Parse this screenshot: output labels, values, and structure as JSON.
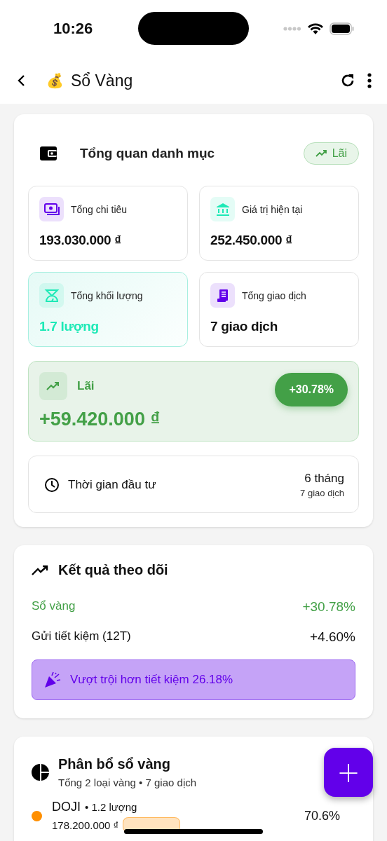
{
  "status_bar": {
    "time": "10:26"
  },
  "app_bar": {
    "emoji": "💰",
    "title": "Sổ Vàng"
  },
  "overview": {
    "title": "Tổng quan danh mục",
    "badge": "Lãi",
    "tiles": [
      {
        "label": "Tổng chi tiêu",
        "value": "193.030.000 ₫",
        "kind": "money",
        "color": "#6200ea",
        "highlighted": false
      },
      {
        "label": "Giá trị hiện tại",
        "value": "252.450.000 ₫",
        "kind": "bank",
        "color": "#1de9b6",
        "highlighted": false
      },
      {
        "label": "Tổng khối lượng",
        "value": "1.7 lượng",
        "kind": "scale",
        "color": "#1de9b6",
        "highlighted": true
      },
      {
        "label": "Tổng giao dịch",
        "value": "7 giao dịch",
        "kind": "receipt",
        "color": "#6200ea",
        "highlighted": false
      }
    ],
    "profit": {
      "label": "Lãi",
      "amount": "+59.420.000 ₫",
      "percent": "+30.78%"
    },
    "duration": {
      "label": "Thời gian đầu tư",
      "value": "6 tháng",
      "sub": "7 giao dịch"
    }
  },
  "results": {
    "title": "Kết quả theo dõi",
    "rows": [
      {
        "label": "Sổ vàng",
        "value": "+30.78%",
        "highlighted": true
      },
      {
        "label": "Gửi tiết kiệm (12T)",
        "value": "+4.60%",
        "highlighted": false
      }
    ],
    "banner": "Vượt trội hơn tiết kiệm 26.18%"
  },
  "allocation": {
    "title": "Phân bổ sổ vàng",
    "subtitle": "Tổng 2 loại vàng • 7 giao dịch",
    "items": [
      {
        "name": "DOJI",
        "amount": "• 1.2 lượng",
        "value": "178.200.000 ₫",
        "percent": "70.6%",
        "color": "#ff8f00"
      }
    ]
  },
  "fab": {
    "label": "+"
  }
}
